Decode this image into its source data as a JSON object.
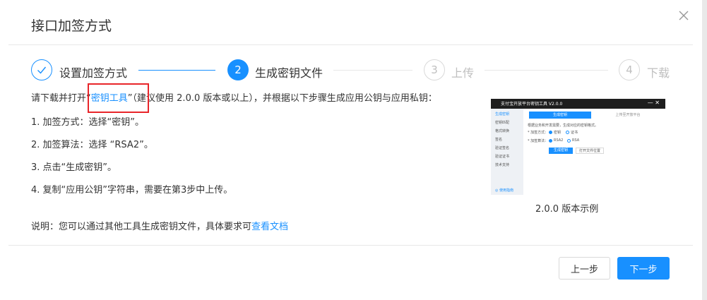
{
  "dialog": {
    "title": "接口加签方式"
  },
  "steps": [
    {
      "index": "1",
      "title": "设置加签方式",
      "status": "done"
    },
    {
      "index": "2",
      "title": "生成密钥文件",
      "status": "active"
    },
    {
      "index": "3",
      "title": "上传",
      "status": "wait"
    },
    {
      "index": "4",
      "title": "下载",
      "status": "wait"
    }
  ],
  "content": {
    "intro_prefix": "请下载并打开",
    "intro_quote_open": "“",
    "tool_link": "密钥工具",
    "intro_quote_close": "”",
    "intro_suffix": "（建议使用 2.0.0 版本或以上），并根据以下步骤生成应用公钥与应用私钥：",
    "step1": "1. 加签方式：选择“密钥”。",
    "step2": "2. 加签算法：选择 “RSA2”。",
    "step3": "3. 点击“生成密钥”。",
    "step4": "4. 复制“应用公钥”字符串，需要在第3步中上传。",
    "note_prefix": "说明：您可以通过其他工具生成密钥文件，具体要求可",
    "doc_link": "查看文档"
  },
  "preview": {
    "caption": "2.0.0 版本示例",
    "window_title": "支付宝开放平台密钥工具 V2.0.0",
    "sidebar": [
      "生成密钥",
      "密钥匹配",
      "格式转换",
      "签名",
      "验证签名",
      "验证证书",
      "技术支持"
    ],
    "sidebar_footer": "◎ 使用指南",
    "tab_active": "生成密钥",
    "tab_inactive": "上传至开放平台",
    "hint": "根据业务和开发需要，生成对应的密钥格式。",
    "row1_label": "* 加签方式：",
    "row1_opt1": "密钥",
    "row1_opt2": "证书",
    "row2_label": "* 加签算法：",
    "row2_opt1": "RSA2",
    "row2_opt2": "RSA",
    "btn_generate": "生成密钥",
    "btn_open": "打开文件位置"
  },
  "footer": {
    "prev_label": "上一步",
    "next_label": "下一步"
  },
  "colors": {
    "primary": "#1890ff",
    "highlight": "#e8252a"
  },
  "icons": {
    "close": "close-icon",
    "check": "check-icon"
  }
}
